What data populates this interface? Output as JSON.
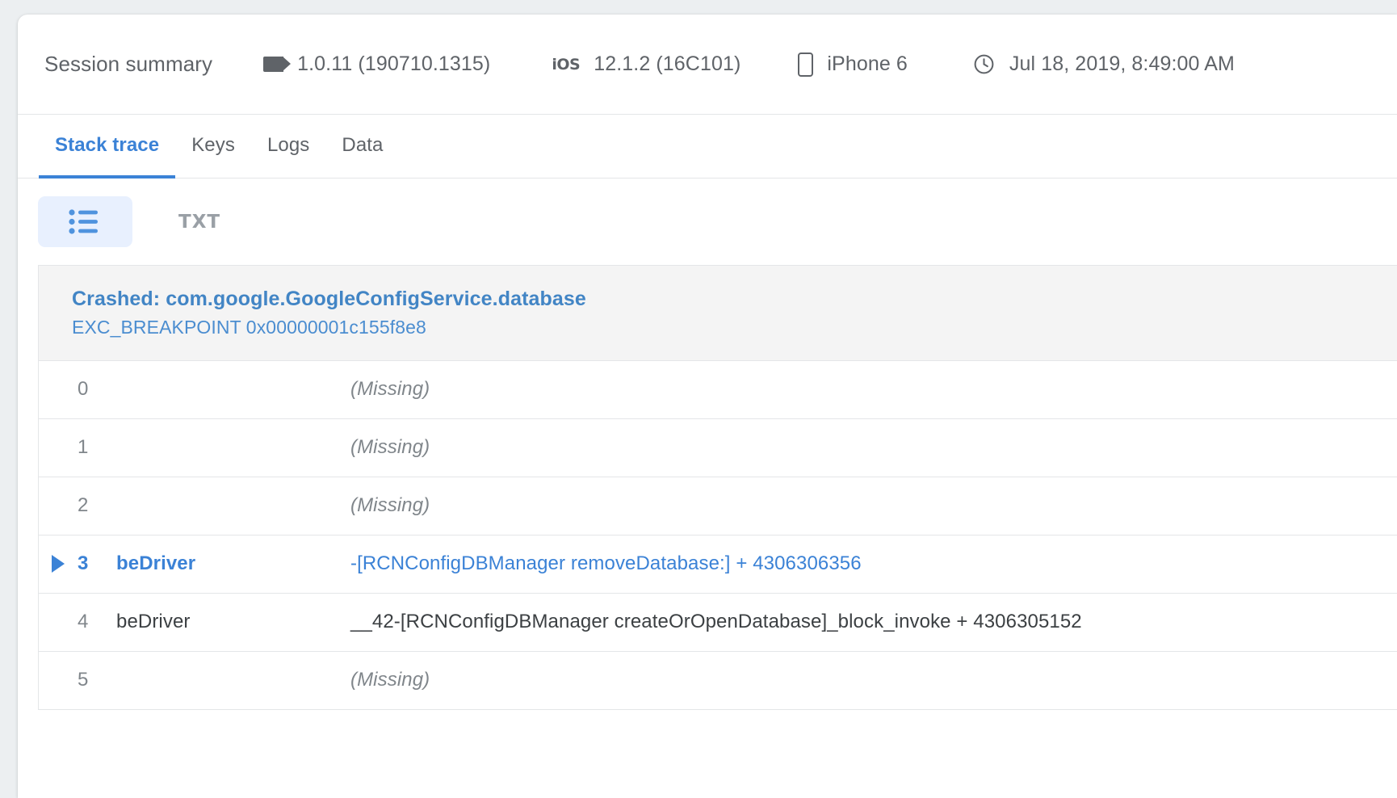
{
  "summary": {
    "title": "Session summary",
    "version_icon": "tag-icon",
    "version": "1.0.11 (190710.1315)",
    "os_icon": "ios-icon",
    "os_icon_text": "iOS",
    "os_version": "12.1.2 (16C101)",
    "device_icon": "phone-icon",
    "device": "iPhone 6",
    "time_icon": "clock-icon",
    "timestamp": "Jul 18, 2019, 8:49:00 AM"
  },
  "tabs": [
    {
      "label": "Stack trace",
      "active": true
    },
    {
      "label": "Keys",
      "active": false
    },
    {
      "label": "Logs",
      "active": false
    },
    {
      "label": "Data",
      "active": false
    }
  ],
  "toolbar": {
    "list_view_icon": "list-view-icon",
    "txt_label": "TXT"
  },
  "crash": {
    "title": "Crashed: com.google.GoogleConfigService.database",
    "exception": "EXC_BREAKPOINT 0x00000001c155f8e8"
  },
  "frames": [
    {
      "index": "0",
      "library": "",
      "symbol": "(Missing)",
      "missing": true,
      "selected": false
    },
    {
      "index": "1",
      "library": "",
      "symbol": "(Missing)",
      "missing": true,
      "selected": false
    },
    {
      "index": "2",
      "library": "",
      "symbol": "(Missing)",
      "missing": true,
      "selected": false
    },
    {
      "index": "3",
      "library": "beDriver",
      "symbol": "-[RCNConfigDBManager removeDatabase:] + 4306306356",
      "missing": false,
      "selected": true
    },
    {
      "index": "4",
      "library": "beDriver",
      "symbol": "__42-[RCNConfigDBManager createOrOpenDatabase]_block_invoke + 4306305152",
      "missing": false,
      "selected": false
    },
    {
      "index": "5",
      "library": "",
      "symbol": "(Missing)",
      "missing": true,
      "selected": false
    }
  ],
  "colors": {
    "accent": "#3b82d6",
    "crash_title": "#4285c5",
    "text_primary": "#3c4043",
    "text_secondary": "#5f6368",
    "text_muted": "#80868b",
    "toggle_bg": "#e8f0fe",
    "crash_header_bg": "#f4f4f4",
    "border": "#e4e6e8"
  }
}
